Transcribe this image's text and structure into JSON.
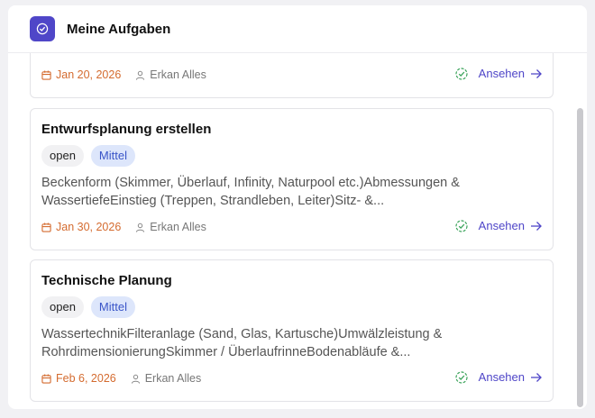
{
  "header": {
    "title": "Meine Aufgaben",
    "icon": "check-circle-icon"
  },
  "colors": {
    "accent": "#4f46c8",
    "date": "#d46b2f",
    "check": "#3aa35a",
    "priority_bg": "#dde6fb"
  },
  "tasks": [
    {
      "title": "",
      "status": "",
      "priority": "",
      "description": "",
      "date": "Jan 20, 2026",
      "assignee": "Erkan Alles",
      "action": "Ansehen"
    },
    {
      "title": "Entwurfsplanung erstellen",
      "status": "open",
      "priority": "Mittel",
      "description": "Beckenform (Skimmer, Überlauf, Infinity, Naturpool etc.)Abmessungen & WassertiefeEinstieg (Treppen, Strandleben, Leiter)Sitz- &...",
      "date": "Jan 30, 2026",
      "assignee": "Erkan Alles",
      "action": "Ansehen"
    },
    {
      "title": "Technische Planung",
      "status": "open",
      "priority": "Mittel",
      "description": "WassertechnikFilteranlage (Sand, Glas, Kartusche)Umwälzleistung & RohrdimensionierungSkimmer / ÜberlaufrinneBodenabläufe &...",
      "date": "Feb 6, 2026",
      "assignee": "Erkan Alles",
      "action": "Ansehen"
    }
  ]
}
